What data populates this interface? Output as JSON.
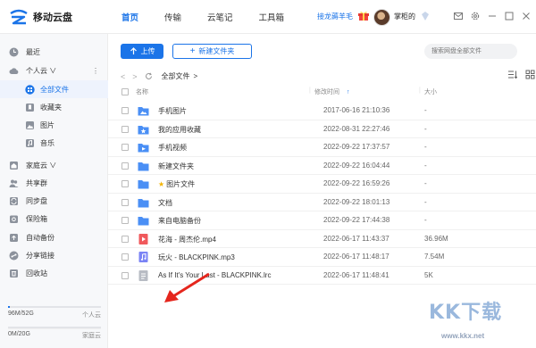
{
  "app": {
    "name": "移动云盘"
  },
  "header": {
    "nav": [
      "首页",
      "传输",
      "云笔记",
      "工具箱"
    ],
    "promo": "接龙薅羊毛",
    "username": "掌柜的"
  },
  "sidebar": {
    "items": [
      {
        "label": "最近",
        "icon": "clock-icon"
      },
      {
        "label": "个人云 ∨",
        "icon": "cloud-icon"
      },
      {
        "label": "全部文件",
        "icon": "grid-icon"
      },
      {
        "label": "收藏夹",
        "icon": "bookmark-icon"
      },
      {
        "label": "图片",
        "icon": "image-icon"
      },
      {
        "label": "音乐",
        "icon": "music-icon"
      },
      {
        "label": "家庭云 ∨",
        "icon": "home-icon"
      },
      {
        "label": "共享群",
        "icon": "group-icon"
      },
      {
        "label": "同步盘",
        "icon": "sync-icon"
      },
      {
        "label": "保险箱",
        "icon": "safe-icon"
      },
      {
        "label": "自动备份",
        "icon": "backup-icon"
      },
      {
        "label": "分享链接",
        "icon": "link-icon"
      },
      {
        "label": "回收站",
        "icon": "trash-icon"
      }
    ],
    "more": "⋮",
    "storage": [
      {
        "used": "96M/52G",
        "label": "个人云",
        "fraction": 0.02
      },
      {
        "used": "0M/20G",
        "label": "家庭云",
        "fraction": 0.0
      }
    ]
  },
  "toolbar": {
    "upload": "上传",
    "new_folder": "新建文件夹",
    "search_placeholder": "搜索网盘全部文件"
  },
  "breadcrumb": {
    "label": "全部文件",
    "sep": ">"
  },
  "table": {
    "headers": {
      "name": "名称",
      "time": "修改时间",
      "size": "大小"
    },
    "sort_indicator": "↑",
    "rows": [
      {
        "name": "手机图片",
        "time": "2017-06-16 21:10:36",
        "size": "-",
        "type": "folder-image",
        "star": false
      },
      {
        "name": "我的应用收藏",
        "time": "2022-08-31 22:27:46",
        "size": "-",
        "type": "folder-app",
        "star": false
      },
      {
        "name": "手机视频",
        "time": "2022-09-22 17:37:57",
        "size": "-",
        "type": "folder-video",
        "star": false
      },
      {
        "name": "新建文件夹",
        "time": "2022-09-22 16:04:44",
        "size": "-",
        "type": "folder",
        "star": false
      },
      {
        "name": "图片文件",
        "time": "2022-09-22 16:59:26",
        "size": "-",
        "type": "folder",
        "star": true
      },
      {
        "name": "文档",
        "time": "2022-09-22 18:01:13",
        "size": "-",
        "type": "folder",
        "star": false
      },
      {
        "name": "来自电脑备份",
        "time": "2022-09-22 17:44:38",
        "size": "-",
        "type": "folder",
        "star": false
      },
      {
        "name": "花海 - 周杰伦.mp4",
        "time": "2022-06-17 11:43:37",
        "size": "36.96M",
        "type": "video",
        "star": false
      },
      {
        "name": "玩火 - BLACKPINK.mp3",
        "time": "2022-06-17 11:48:17",
        "size": "7.54M",
        "type": "audio",
        "star": false
      },
      {
        "name": "As If It's Your Last - BLACKPINK.lrc",
        "time": "2022-06-17 11:48:41",
        "size": "5K",
        "type": "text",
        "star": false
      }
    ]
  },
  "watermark": {
    "text": "KK下载",
    "url": "www.kkx.net"
  },
  "colors": {
    "accent": "#1b74e8",
    "folder": "#4a8ff5"
  }
}
